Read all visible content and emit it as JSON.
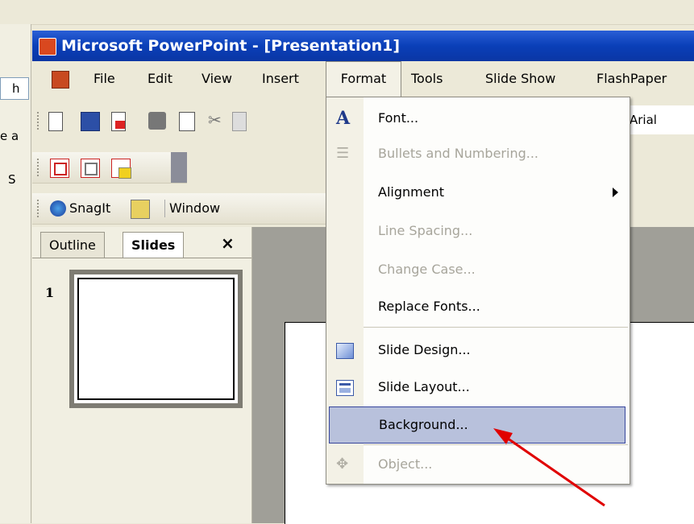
{
  "window": {
    "title": "Microsoft PowerPoint - [Presentation1]"
  },
  "menubar": {
    "items": [
      "File",
      "Edit",
      "View",
      "Insert",
      "Format",
      "Tools",
      "Slide Show",
      "FlashPaper"
    ],
    "open_item": "Format"
  },
  "left_strip": {
    "frag1": "h",
    "frag2": "e a",
    "frag3": "S"
  },
  "toolbar": {
    "font_name": "Arial",
    "snagit_label": "SnagIt",
    "window_label": "Window"
  },
  "sidebar": {
    "tabs": [
      "Outline",
      "Slides"
    ],
    "active_tab": "Slides",
    "close_glyph": "×",
    "slide_number": "1"
  },
  "format_menu": {
    "items": [
      {
        "label": "Font...",
        "enabled": true,
        "icon": "font-a-icon"
      },
      {
        "label": "Bullets and Numbering...",
        "enabled": false,
        "icon": "bullets-icon"
      },
      {
        "label": "Alignment",
        "enabled": true,
        "submenu": true
      },
      {
        "label": "Line Spacing...",
        "enabled": false
      },
      {
        "label": "Change Case...",
        "enabled": false
      },
      {
        "label": "Replace Fonts...",
        "enabled": true
      },
      {
        "label": "Slide Design...",
        "enabled": true,
        "icon": "slide-design-icon"
      },
      {
        "label": "Slide Layout...",
        "enabled": true,
        "icon": "slide-layout-icon"
      },
      {
        "label": "Background...",
        "enabled": true,
        "highlighted": true
      },
      {
        "label": "Object...",
        "enabled": false,
        "icon": "object-icon"
      }
    ]
  },
  "colors": {
    "titlebar": "#0a3fb8",
    "highlight": "#b8c1dc",
    "annotation_arrow": "#e00000"
  }
}
